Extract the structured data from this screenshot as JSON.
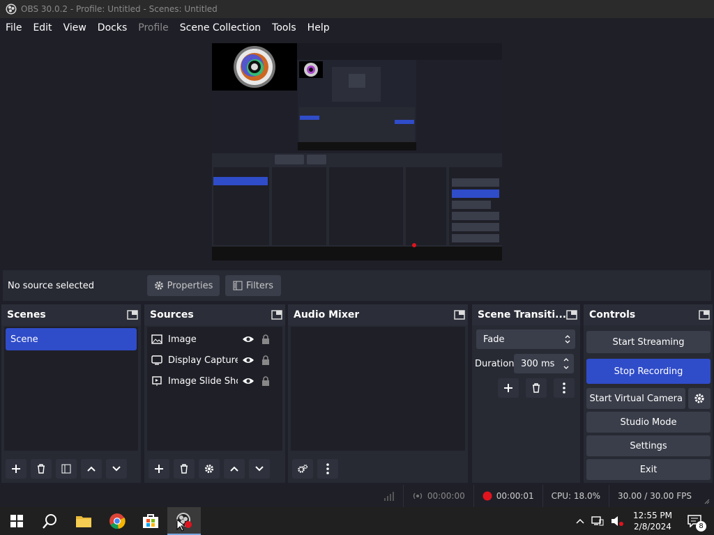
{
  "window": {
    "title": "OBS 30.0.2 - Profile: Untitled - Scenes: Untitled"
  },
  "menu": {
    "items": [
      "File",
      "Edit",
      "View",
      "Docks",
      "Profile",
      "Scene Collection",
      "Tools",
      "Help"
    ],
    "disabled": [
      "Profile"
    ]
  },
  "source_bar": {
    "status": "No source selected",
    "properties_label": "Properties",
    "filters_label": "Filters"
  },
  "scenes": {
    "title": "Scenes",
    "items": [
      "Scene"
    ],
    "selected": "Scene"
  },
  "sources": {
    "title": "Sources",
    "items": [
      {
        "name": "Image",
        "icon": "image-icon"
      },
      {
        "name": "Display Capture",
        "icon": "monitor-icon"
      },
      {
        "name": "Image Slide Show",
        "icon": "slideshow-icon"
      }
    ]
  },
  "audio_mixer": {
    "title": "Audio Mixer"
  },
  "transitions": {
    "title": "Scene Transiti...",
    "transition": "Fade",
    "duration_label": "Duration",
    "duration_value": "300 ms"
  },
  "controls": {
    "title": "Controls",
    "start_streaming": "Start Streaming",
    "stop_recording": "Stop Recording",
    "start_virtual_camera": "Start Virtual Camera",
    "studio_mode": "Studio Mode",
    "settings": "Settings",
    "exit": "Exit"
  },
  "status": {
    "stream_time": "00:00:00",
    "record_time": "00:00:01",
    "cpu": "CPU: 18.0%",
    "fps": "30.00 / 30.00 FPS"
  },
  "taskbar": {
    "time": "12:55 PM",
    "date": "2/8/2024",
    "notifications": "8"
  },
  "colors": {
    "accent": "#2f4cc9",
    "record": "#e0141e",
    "background": "#1f1f28",
    "dock": "#272a33"
  }
}
